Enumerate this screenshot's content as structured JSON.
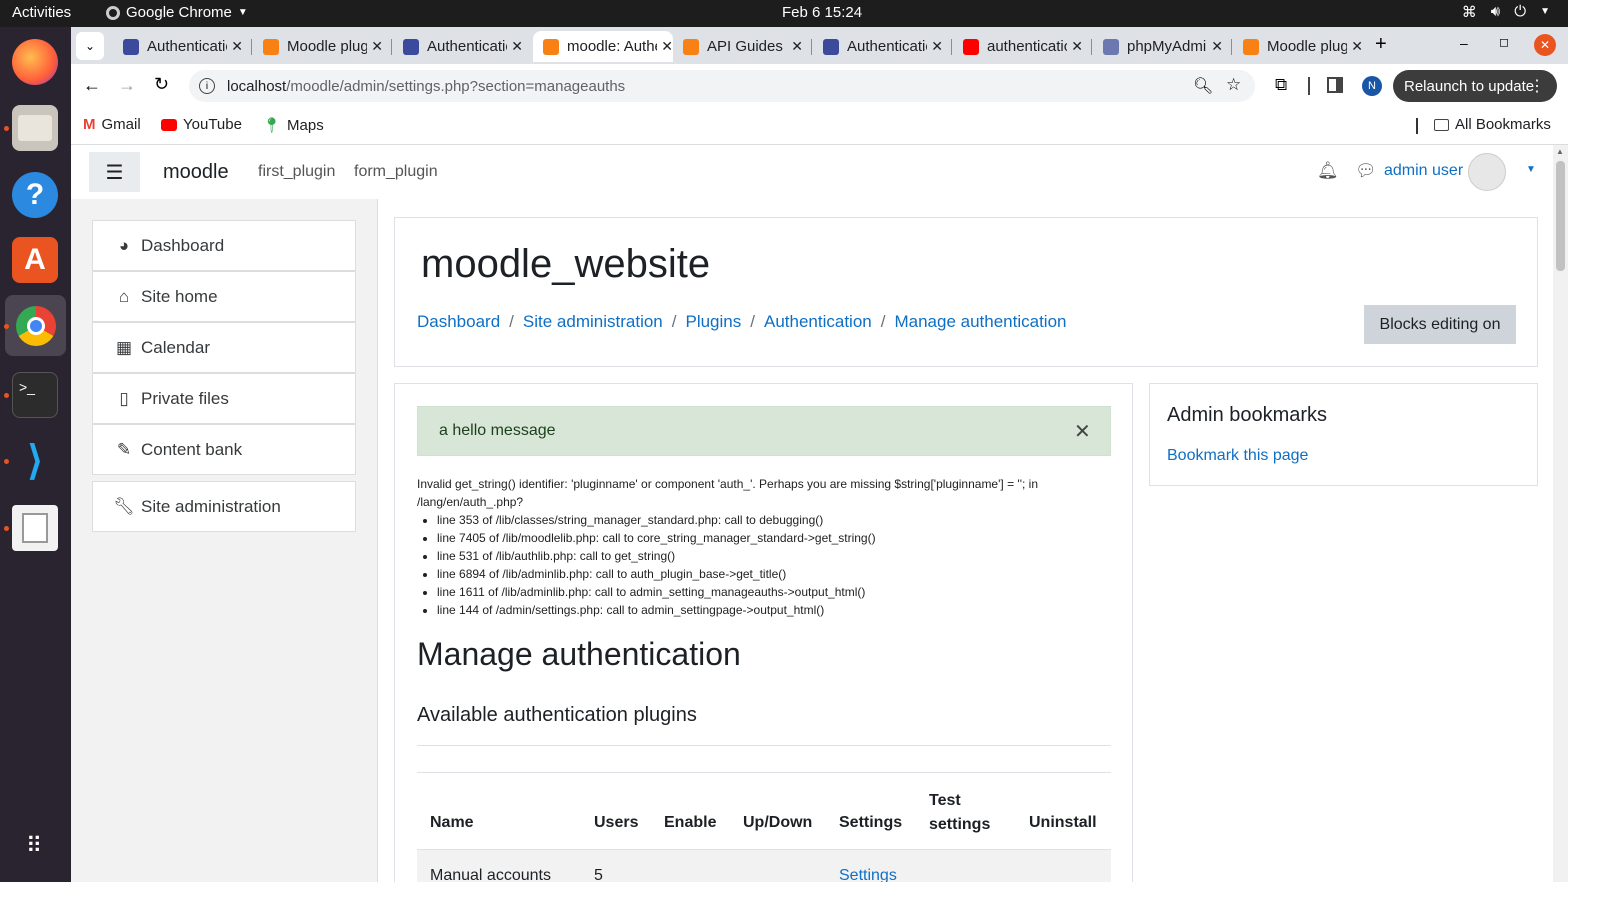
{
  "system": {
    "activities": "Activities",
    "app_name": "Google Chrome",
    "clock": "Feb 6  15:24"
  },
  "tabs": [
    {
      "title": "Authentication",
      "icon": "moodle-docs-icon",
      "color": "#3b4a9c"
    },
    {
      "title": "Moodle plugins",
      "icon": "moodle-icon",
      "color": "#f98012"
    },
    {
      "title": "Authentication",
      "icon": "moodle-docs-icon",
      "color": "#3b4a9c"
    },
    {
      "title": "moodle: Authentication",
      "icon": "moodle-icon",
      "color": "#f98012",
      "active": true
    },
    {
      "title": "API Guides",
      "icon": "moodle-icon",
      "color": "#f98012"
    },
    {
      "title": "Authentication",
      "icon": "moodle-docs-icon",
      "color": "#3b4a9c"
    },
    {
      "title": "authentication",
      "icon": "youtube-icon",
      "color": "#ff0000"
    },
    {
      "title": "phpMyAdmin",
      "icon": "phpmyadmin-icon",
      "color": "#6c78af"
    },
    {
      "title": "Moodle plugins",
      "icon": "moodle-icon",
      "color": "#f98012"
    }
  ],
  "url": {
    "host": "localhost",
    "path": "/moodle/admin/settings.php?section=manageauths"
  },
  "relaunch": "Relaunch to update",
  "profile_initial": "N",
  "bookmarks": {
    "gmail": "Gmail",
    "youtube": "YouTube",
    "maps": "Maps",
    "all": "All Bookmarks"
  },
  "moodle": {
    "brand": "moodle",
    "nav_links": [
      "first_plugin",
      "form_plugin"
    ],
    "user": "admin user",
    "drawer": [
      "Dashboard",
      "Site home",
      "Calendar",
      "Private files",
      "Content bank"
    ],
    "site_admin": "Site administration",
    "site_title": "moodle_website",
    "breadcrumb": [
      "Dashboard",
      "Site administration",
      "Plugins",
      "Authentication",
      "Manage authentication"
    ],
    "blocks_editing": "Blocks editing on",
    "alert": "a hello message",
    "debug_msg": "Invalid get_string() identifier: 'pluginname' or component 'auth_'. Perhaps you are missing $string['pluginname'] = ''; in /lang/en/auth_.php?",
    "debug_trace": [
      "line 353 of /lib/classes/string_manager_standard.php: call to debugging()",
      "line 7405 of /lib/moodlelib.php: call to core_string_manager_standard->get_string()",
      "line 531 of /lib/authlib.php: call to get_string()",
      "line 6894 of /lib/adminlib.php: call to auth_plugin_base->get_title()",
      "line 1611 of /lib/adminlib.php: call to admin_setting_manageauths->output_html()",
      "line 144 of /admin/settings.php: call to admin_settingpage->output_html()"
    ],
    "heading": "Manage authentication",
    "subheading": "Available authentication plugins",
    "table": {
      "headers": [
        "Name",
        "Users",
        "Enable",
        "Up/Down",
        "Settings",
        "Test settings",
        "Uninstall"
      ],
      "rows": [
        {
          "name": "Manual accounts",
          "users": "5",
          "settings": "Settings"
        }
      ]
    },
    "bookmarks_block": {
      "title": "Admin bookmarks",
      "link": "Bookmark this page"
    }
  }
}
